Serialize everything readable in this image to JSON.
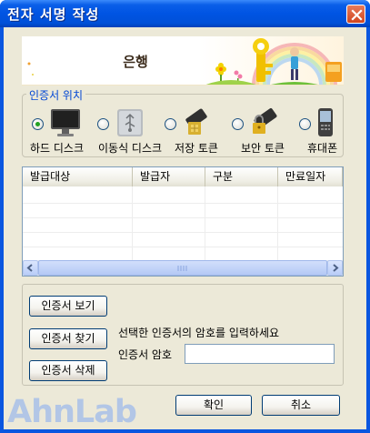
{
  "window": {
    "title": "전자 서명 작성"
  },
  "banner": {
    "title": "은행"
  },
  "cert_location": {
    "legend": "인증서 위치",
    "options": [
      {
        "label": "하드 디스크",
        "icon": "monitor-icon",
        "selected": true
      },
      {
        "label": "이동식 디스크",
        "icon": "usb-drive-icon",
        "selected": false
      },
      {
        "label": "저장 토큰",
        "icon": "storage-token-icon",
        "selected": false
      },
      {
        "label": "보안 토큰",
        "icon": "security-token-icon",
        "selected": false
      },
      {
        "label": "휴대폰",
        "icon": "mobile-phone-icon",
        "selected": false
      }
    ]
  },
  "cert_table": {
    "columns": [
      "발급대상",
      "발급자",
      "구분",
      "만료일자"
    ],
    "rows": []
  },
  "buttons": {
    "view_cert": "인증서   보기",
    "find_cert": "인증서   찾기",
    "delete_cert": "인증서 삭제",
    "ok": "확인",
    "cancel": "취소"
  },
  "password": {
    "prompt": "선택한 인증서의 암호를 입력하세요",
    "label": "인증서 암호",
    "value": ""
  },
  "brand": {
    "logo_text": "AhnLab"
  },
  "colors": {
    "titlebar": "#0054e3",
    "dialog_bg": "#ece9d8",
    "legend": "#0046d5",
    "logo": "#b2c6e6"
  }
}
